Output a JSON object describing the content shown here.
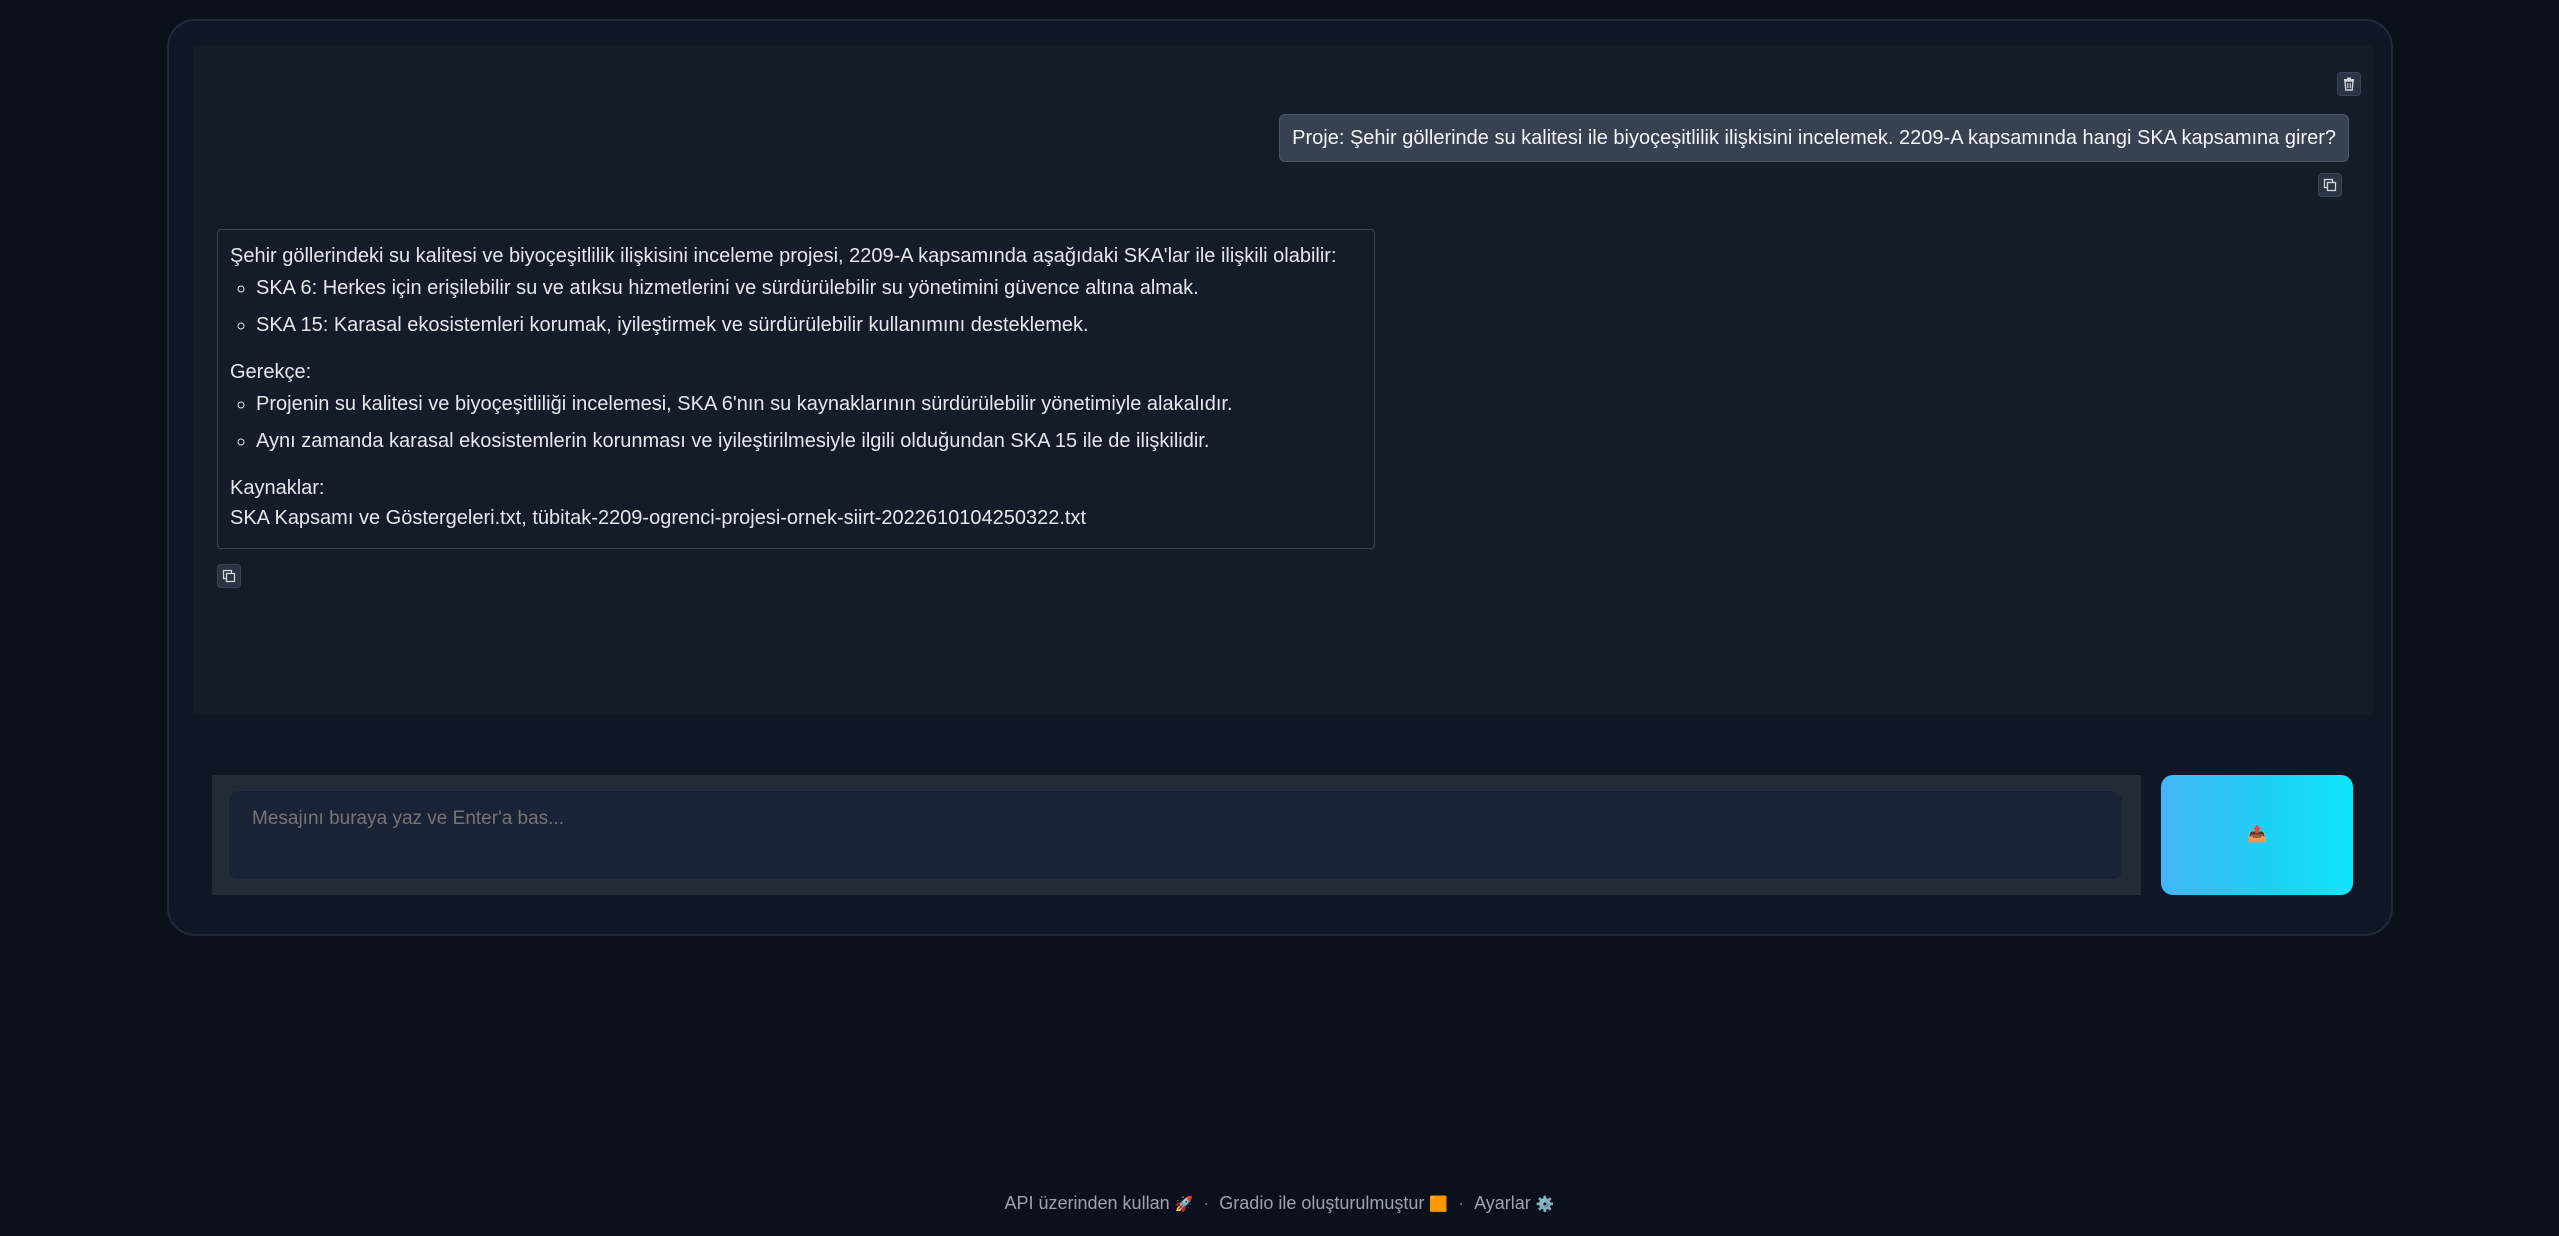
{
  "chat": {
    "user_message": "Proje: Şehir göllerinde su kalitesi ile biyoçeşitlilik ilişkisini incelemek. 2209-A kapsamında hangi SKA kapsamına girer?",
    "bot_message": {
      "intro": "Şehir göllerindeki su kalitesi ve biyoçeşitlilik ilişkisini inceleme projesi, 2209-A kapsamında aşağıdaki SKA'lar ile ilişkili olabilir:",
      "list1": [
        "SKA 6: Herkes için erişilebilir su ve atıksu hizmetlerini ve sürdürülebilir su yönetimini güvence altına almak.",
        "SKA 15: Karasal ekosistemleri korumak, iyileştirmek ve sürdürülebilir kullanımını desteklemek."
      ],
      "rationale_label": "Gerekçe:",
      "list2": [
        "Projenin su kalitesi ve biyoçeşitliliği incelemesi, SKA 6'nın su kaynaklarının sürdürülebilir yönetimiyle alakalıdır.",
        "Aynı zamanda karasal ekosistemlerin korunması ve iyileştirilmesiyle ilgili olduğundan SKA 15 ile de ilişkilidir."
      ],
      "sources_label": "Kaynaklar:",
      "sources": "SKA Kapsamı ve Göstergeleri.txt, tübitak-2209-ogrenci-projesi-ornek-siirt-2022610104250322.txt"
    }
  },
  "input": {
    "placeholder": "Mesajını buraya yaz ve Enter'a bas..."
  },
  "send_button": {
    "icon": "📤"
  },
  "footer": {
    "api_link": "API üzerinden kullan",
    "api_emoji": "🚀",
    "gradio_link": "Gradio ile oluşturulmuştur",
    "gradio_emoji": "🟧",
    "settings_link": "Ayarlar",
    "settings_emoji": "⚙️",
    "separator": "·"
  }
}
